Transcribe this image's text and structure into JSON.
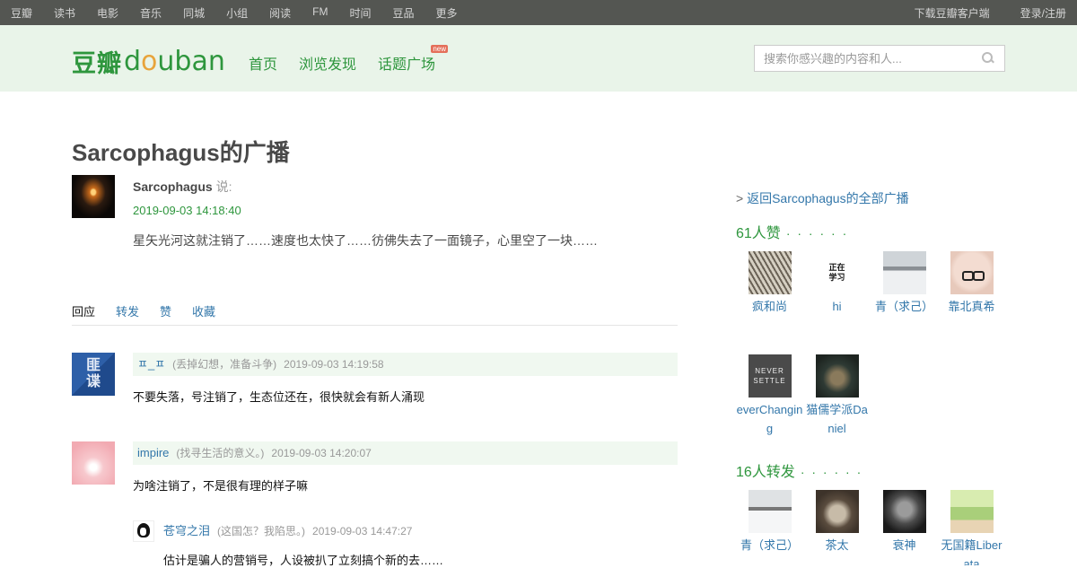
{
  "topbar": {
    "nav": [
      "豆瓣",
      "读书",
      "电影",
      "音乐",
      "同城",
      "小组",
      "阅读",
      "FM",
      "时间",
      "豆品",
      "更多"
    ],
    "download": "下载豆瓣客户端",
    "login": "登录/注册"
  },
  "header": {
    "logo_cn": "豆瓣",
    "logo_en_pre": "d",
    "logo_en_o": "o",
    "logo_en_post": "uban",
    "nav": [
      "首页",
      "浏览发现",
      "话题广场"
    ],
    "new_badge": "new",
    "search_placeholder": "搜索你感兴趣的内容和人..."
  },
  "status": {
    "page_title": "Sarcophagus的广播",
    "author": "Sarcophagus",
    "said": "说:",
    "time": "2019-09-03 14:18:40",
    "text": "星矢光河这就注销了……速度也太快了……彷佛失去了一面镜子，心里空了一块……"
  },
  "tabs": [
    "回应",
    "转发",
    "赞",
    "收藏"
  ],
  "comments": [
    {
      "name": "ㅍ_ㅍ",
      "signature": "(丢掉幻想，准备斗争)",
      "time": "2019-09-03 14:19:58",
      "text": "不要失落，号注销了，生态位还在，很快就会有新人涌现",
      "avatar_text": "匪\n谍"
    },
    {
      "name": "impire",
      "signature": "(找寻生活的意义。)",
      "time": "2019-09-03 14:20:07",
      "text": "为啥注销了，不是很有理的样子嘛"
    }
  ],
  "reply": {
    "name": "苍穹之泪",
    "signature": "(这国怎？我陷思。)",
    "time": "2019-09-03 14:47:27",
    "text": "估计是骗人的营销号，人设被扒了立刻搞个新的去……"
  },
  "sidebar": {
    "back_prefix": ">",
    "back_link": "返回Sarcophagus的全部广播",
    "likes_title": "61人赞",
    "dots": "· · · · · ·",
    "likes": [
      {
        "name": "疯和尚"
      },
      {
        "name": "hi",
        "avatar_text": "正在\n学习"
      },
      {
        "name": "青（求己）"
      },
      {
        "name": "靠北真希"
      },
      {
        "name": "everChanging",
        "avatar_text": "NEVER\nSETTLE"
      },
      {
        "name": "猫儒学派Daniel"
      }
    ],
    "reshares_title": "16人转发",
    "reshares": [
      {
        "name": "青（求己）"
      },
      {
        "name": "茶太"
      },
      {
        "name": "衰神"
      },
      {
        "name": "无国籍Liberata"
      }
    ]
  }
}
